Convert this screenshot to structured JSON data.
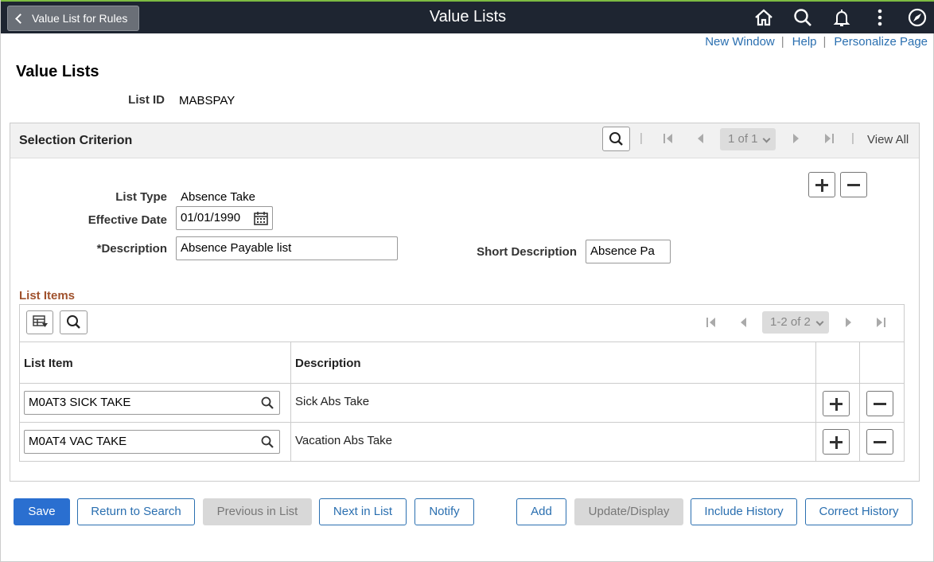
{
  "banner": {
    "back_label": "Value List for Rules",
    "title": "Value Lists"
  },
  "links": {
    "new_window": "New Window",
    "help": "Help",
    "personalize": "Personalize Page",
    "separator": "|"
  },
  "page": {
    "title": "Value Lists",
    "list_id_label": "List ID",
    "list_id_value": "MABSPAY"
  },
  "selection": {
    "title": "Selection Criterion",
    "pager": "1 of 1",
    "view_all": "View All",
    "divider": "|",
    "list_type_label": "List Type",
    "list_type_value": "Absence Take",
    "effective_date_label": "Effective Date",
    "effective_date_value": "01/01/1990",
    "description_label": "*Description",
    "description_value": "Absence Payable list",
    "short_description_label": "Short Description",
    "short_description_value": "Absence Pa"
  },
  "list_items": {
    "title": "List Items",
    "pager": "1-2 of 2",
    "columns": {
      "item": "List Item",
      "description": "Description"
    },
    "rows": [
      {
        "item": "M0AT3 SICK TAKE",
        "description": "Sick Abs Take"
      },
      {
        "item": "M0AT4 VAC TAKE",
        "description": "Vacation Abs Take"
      }
    ]
  },
  "buttons": {
    "save": "Save",
    "return_to_search": "Return to Search",
    "previous_in_list": "Previous in List",
    "next_in_list": "Next in List",
    "notify": "Notify",
    "add": "Add",
    "update_display": "Update/Display",
    "include_history": "Include History",
    "correct_history": "Correct History"
  },
  "colors": {
    "banner_bg": "#1e2531",
    "link_blue": "#2a6fb0",
    "primary_button": "#2a6fd0",
    "section_title": "#a0522d"
  }
}
